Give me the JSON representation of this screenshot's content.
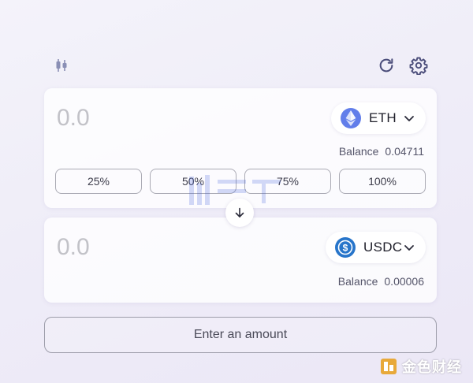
{
  "from": {
    "amount_placeholder": "0.0",
    "token": {
      "symbol": "ETH",
      "icon": "eth-logo-icon",
      "color": "#627eea"
    },
    "balance_label": "Balance",
    "balance_value": "0.04711",
    "percent_buttons": [
      "25%",
      "50%",
      "75%",
      "100%"
    ]
  },
  "to": {
    "amount_placeholder": "0.0",
    "token": {
      "symbol": "USDC",
      "icon": "usdc-logo-icon",
      "color": "#2775ca"
    },
    "balance_label": "Balance",
    "balance_value": "0.00006"
  },
  "actions": {
    "submit_label": "Enter an amount"
  },
  "watermarks": {
    "corner_text": "金色财经"
  },
  "colors": {
    "icon": "#4b4d7a",
    "border": "#aaaab4"
  }
}
